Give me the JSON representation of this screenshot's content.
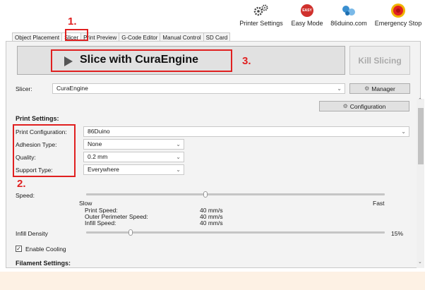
{
  "annotations": {
    "n1": "1.",
    "n2": "2.",
    "n3": "3."
  },
  "toolbar": [
    {
      "label": "Printer Settings",
      "icon": "gears-icon"
    },
    {
      "label": "Easy Mode",
      "icon": "easy-icon",
      "badge": "EASY"
    },
    {
      "label": "86duino.com",
      "icon": "web-icon"
    },
    {
      "label": "Emergency Stop",
      "icon": "stop-icon"
    }
  ],
  "tabs": [
    "Object Placement",
    "Slicer",
    "Print Preview",
    "G-Code Editor",
    "Manual Control",
    "SD Card"
  ],
  "slicer": {
    "slice_label": "Slice with CuraEngine",
    "kill_label": "Kill Slicing",
    "slicer_label": "Slicer:",
    "slicer_value": "CuraEngine",
    "manager_label": "Manager",
    "configuration_label": "Configuration"
  },
  "print_settings": {
    "heading": "Print Settings:",
    "fields": [
      {
        "label": "Print Configuration:",
        "value": "86Duino"
      },
      {
        "label": "Adhesion Type:",
        "value": "None"
      },
      {
        "label": "Quality:",
        "value": "0.2 mm"
      },
      {
        "label": "Support Type:",
        "value": "Everywhere"
      }
    ]
  },
  "speed": {
    "label": "Speed:",
    "slow": "Slow",
    "fast": "Fast",
    "level": 0.4,
    "rows": [
      {
        "label": "Print Speed:",
        "value": "40 mm/s"
      },
      {
        "label": "Outer Perimeter Speed:",
        "value": "40 mm/s"
      },
      {
        "label": "Infill Speed:",
        "value": "40 mm/s"
      }
    ]
  },
  "infill": {
    "label": "Infill Density",
    "value": "15%",
    "level": 0.15
  },
  "cooling": {
    "label": "Enable Cooling",
    "checked": true
  },
  "filament": {
    "heading": "Filament Settings:"
  },
  "colors": {
    "annotation": "#e02020",
    "panel": "#f3f3f3",
    "button": "#e1e1e1"
  }
}
